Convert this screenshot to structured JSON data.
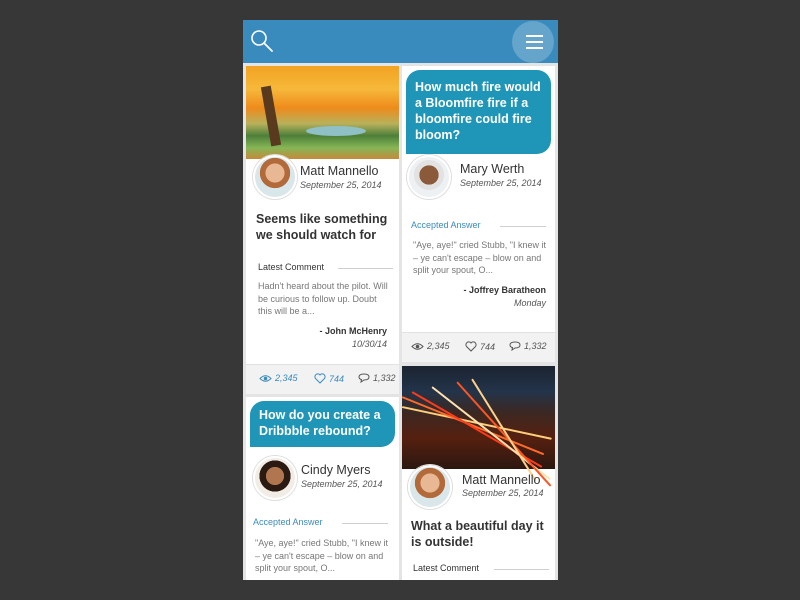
{
  "header": {
    "search_icon": "search-icon",
    "menu_icon": "hamburger-menu-icon"
  },
  "colors": {
    "header_bg": "#3a8bbd",
    "bubble_bg": "#1f96b7",
    "accent": "#3a8bbd"
  },
  "cards": {
    "c1": {
      "type": "post",
      "image": "autumn tree by pond",
      "author": "Matt Mannello",
      "date": "September 25, 2014",
      "title": "Seems like something we should watch for",
      "section_label": "Latest Comment",
      "excerpt": "Hadn't heard about the pilot. Will be curious to follow up. Doubt this will be a...",
      "comment_author": "- John McHenry",
      "comment_date": "10/30/14",
      "views": "2,345",
      "likes": "744",
      "comments": "1,332"
    },
    "c2": {
      "type": "question",
      "question": "How do you create a Dribbble rebound?",
      "author": "Cindy Myers",
      "date": "September 25, 2014",
      "section_label": "Accepted Answer",
      "excerpt": "\"Aye, aye!\" cried Stubb, \"I knew it – ye can't escape – blow on and split your spout, O..."
    },
    "c3": {
      "type": "question",
      "question": "How much fire would a Bloomfire fire if a bloomfire could fire bloom?",
      "author": "Mary Werth",
      "date": "September 25, 2014",
      "section_label": "Accepted Answer",
      "excerpt": "\"Aye, aye!\" cried Stubb, \"I knew it – ye can't escape – blow on and split your spout, O...",
      "answer_author": "- Joffrey Baratheon",
      "answer_date": "Monday",
      "views": "2,345",
      "likes": "744",
      "comments": "1,332"
    },
    "c4": {
      "type": "post",
      "image": "highway light trails at night",
      "author": "Matt Mannello",
      "date": "September 25, 2014",
      "title": "What a beautiful day it is outside!",
      "section_label": "Latest Comment"
    }
  }
}
